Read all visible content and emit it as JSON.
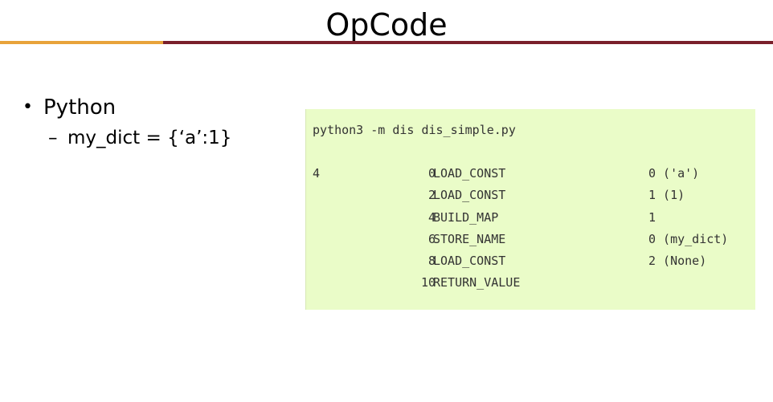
{
  "slide": {
    "title": "OpCode"
  },
  "bullets": {
    "level1_marker": "•",
    "level1_text": "Python",
    "level2_marker": "–",
    "level2_text": "my_dict = {‘a’:1}"
  },
  "code": {
    "command": "python3 -m dis dis_simple.py",
    "rows": [
      {
        "line": "4",
        "offset": "0",
        "opname": "LOAD_CONST",
        "arg": "0 ('a')"
      },
      {
        "line": "",
        "offset": "2",
        "opname": "LOAD_CONST",
        "arg": "1 (1)"
      },
      {
        "line": "",
        "offset": "4",
        "opname": "BUILD_MAP",
        "arg": "1"
      },
      {
        "line": "",
        "offset": "6",
        "opname": "STORE_NAME",
        "arg": "0 (my_dict)"
      },
      {
        "line": "",
        "offset": "8",
        "opname": "LOAD_CONST",
        "arg": "2 (None)"
      },
      {
        "line": "",
        "offset": "10",
        "opname": "RETURN_VALUE",
        "arg": ""
      }
    ]
  },
  "colors": {
    "accent_orange": "#e8a33a",
    "accent_maroon": "#7a1f2b",
    "code_background": "#eafcc8"
  }
}
